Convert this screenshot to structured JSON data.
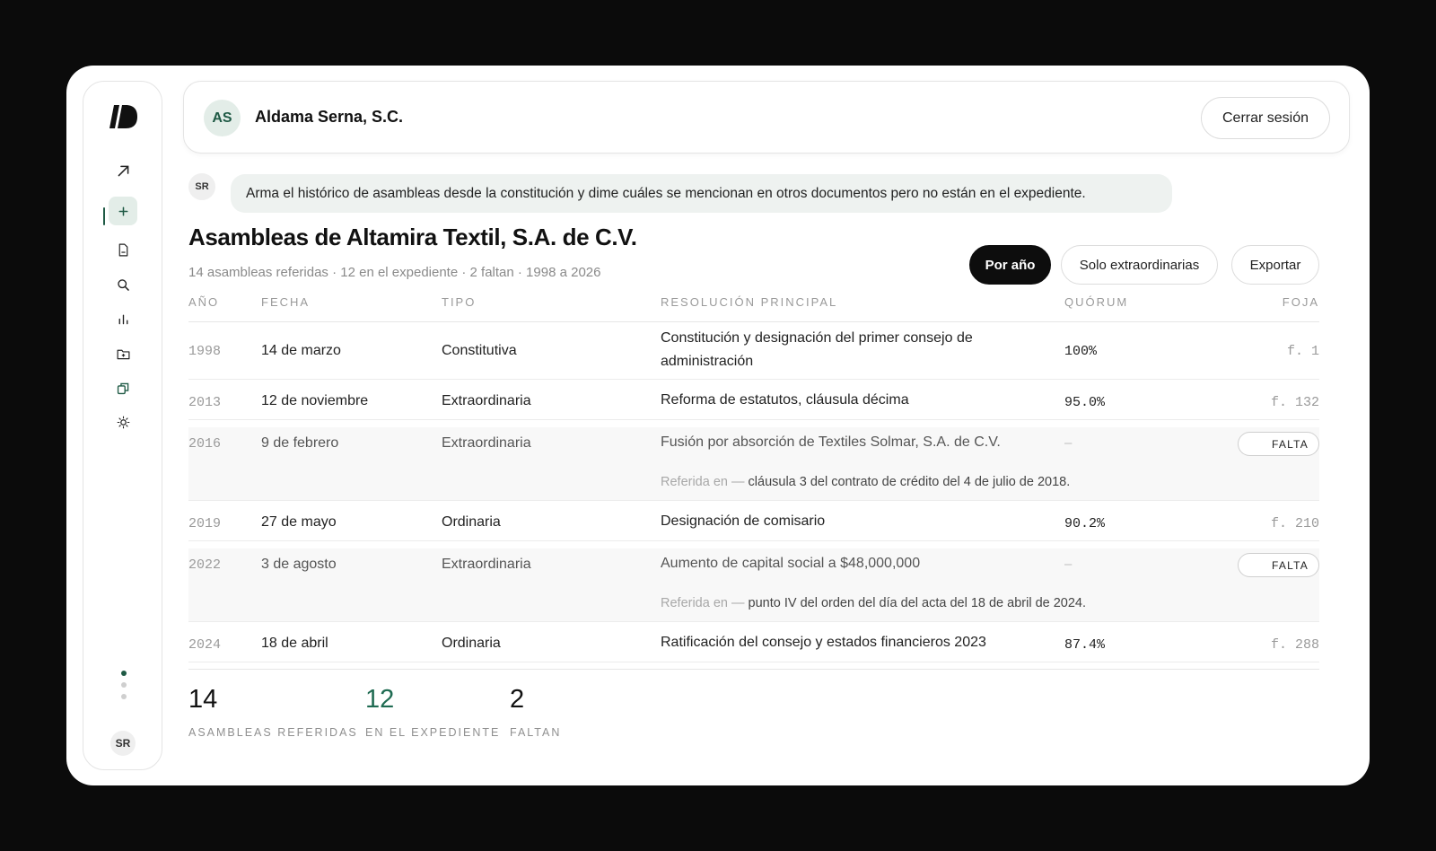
{
  "header": {
    "avatar_initials": "AS",
    "company_name": "Aldama Serna, S.C.",
    "logout_label": "Cerrar sesión"
  },
  "sidebar": {
    "items": [
      {
        "icon": "arrow-up-right-icon"
      },
      {
        "icon": "plus-icon",
        "active": true
      },
      {
        "icon": "document-icon"
      },
      {
        "icon": "search-icon"
      },
      {
        "icon": "bar-chart-icon"
      },
      {
        "icon": "folder-plus-icon"
      },
      {
        "icon": "copy-icon"
      },
      {
        "icon": "sun-icon"
      }
    ],
    "user_initials": "SR"
  },
  "prompt": {
    "user_initials": "SR",
    "text": "Arma el histórico de asambleas desde la constitución y dime cuáles se mencionan en otros documentos pero no están en el expediente."
  },
  "page": {
    "title": "Asambleas de Altamira Textil, S.A. de C.V.",
    "subtitle": "14 asambleas referidas · 12 en el expediente · 2 faltan · 1998 a 2026"
  },
  "toolbar": {
    "by_year": "Por año",
    "extraordinary_only": "Solo extraordinarias",
    "export": "Exportar"
  },
  "table": {
    "columns": [
      "AÑO",
      "FECHA",
      "TIPO",
      "RESOLUCIÓN PRINCIPAL",
      "QUÓRUM",
      "FOJA"
    ],
    "rows": [
      {
        "year": "1998",
        "date": "14 de marzo",
        "type": "Constitutiva",
        "resolution": "Constitución y designación del primer consejo de administración",
        "quorum": "100%",
        "foja": "f. 1"
      },
      {
        "year": "2013",
        "date": "12 de noviembre",
        "type": "Extraordinaria",
        "resolution": "Reforma de estatutos, cláusula décima",
        "quorum": "95.0%",
        "foja": "f. 132"
      },
      {
        "year": "2016",
        "date": "9 de febrero",
        "type": "Extraordinaria",
        "resolution": "Fusión por absorción de Textiles Solmar, S.A. de C.V.",
        "quorum": "–",
        "badge": "FALTA",
        "ref_label": "Referida en —",
        "ref_text": "cláusula 3 del contrato de crédito del 4 de julio de 2018."
      },
      {
        "year": "2019",
        "date": "27 de mayo",
        "type": "Ordinaria",
        "resolution": "Designación de comisario",
        "quorum": "90.2%",
        "foja": "f. 210"
      },
      {
        "year": "2022",
        "date": "3 de agosto",
        "type": "Extraordinaria",
        "resolution": "Aumento de capital social a $48,000,000",
        "quorum": "–",
        "badge": "FALTA",
        "ref_label": "Referida en —",
        "ref_text": "punto IV del orden del día del acta del 18 de abril de 2024."
      },
      {
        "year": "2024",
        "date": "18 de abril",
        "type": "Ordinaria",
        "resolution": "Ratificación del consejo y estados financieros 2023",
        "quorum": "87.4%",
        "foja": "f. 288"
      }
    ]
  },
  "stats": [
    {
      "value": "14",
      "label": "ASAMBLEAS REFERIDAS"
    },
    {
      "value": "12",
      "label": "EN EL EXPEDIENTE"
    },
    {
      "value": "2",
      "label": "FALTAN"
    }
  ],
  "colors": {
    "accent": "#1f5a45",
    "accent_light": "#e3ede8",
    "stat_green": "#1f6b52"
  }
}
